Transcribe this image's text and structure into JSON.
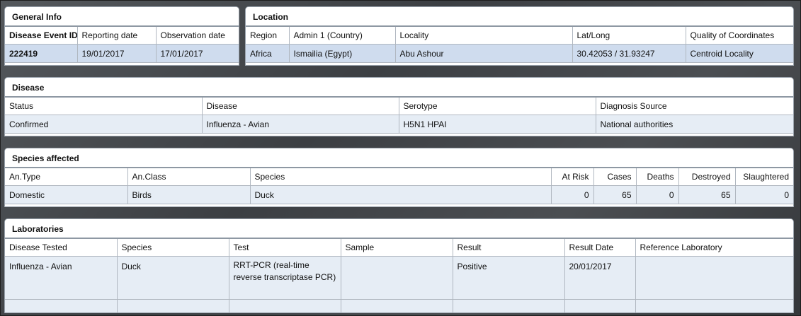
{
  "general": {
    "title": "General Info",
    "headers": [
      "Disease Event ID",
      "Reporting date",
      "Observation date"
    ],
    "values": [
      "222419",
      "19/01/2017",
      "17/01/2017"
    ]
  },
  "location": {
    "title": "Location",
    "headers": [
      "Region",
      "Admin 1 (Country)",
      "Locality",
      "Lat/Long",
      "Quality of Coordinates"
    ],
    "values": [
      "Africa",
      "Ismailia (Egypt)",
      "Abu Ashour",
      "30.42053 / 31.93247",
      "Centroid Locality"
    ]
  },
  "disease": {
    "title": "Disease",
    "headers": [
      "Status",
      "Disease",
      "Serotype",
      "Diagnosis Source"
    ],
    "values": [
      "Confirmed",
      "Influenza - Avian",
      "H5N1 HPAI",
      "National authorities"
    ]
  },
  "species": {
    "title": "Species affected",
    "headers": [
      "An.Type",
      "An.Class",
      "Species",
      "At Risk",
      "Cases",
      "Deaths",
      "Destroyed",
      "Slaughtered"
    ],
    "values": [
      "Domestic",
      "Birds",
      "Duck",
      "0",
      "65",
      "0",
      "65",
      "0"
    ]
  },
  "labs": {
    "title": "Laboratories",
    "headers": [
      "Disease Tested",
      "Species",
      "Test",
      "Sample",
      "Result",
      "Result Date",
      "Reference Laboratory"
    ],
    "values": [
      "Influenza - Avian",
      "Duck",
      "RRT-PCR (real-time reverse transcriptase PCR)",
      "",
      "Positive",
      "20/01/2017",
      ""
    ]
  }
}
